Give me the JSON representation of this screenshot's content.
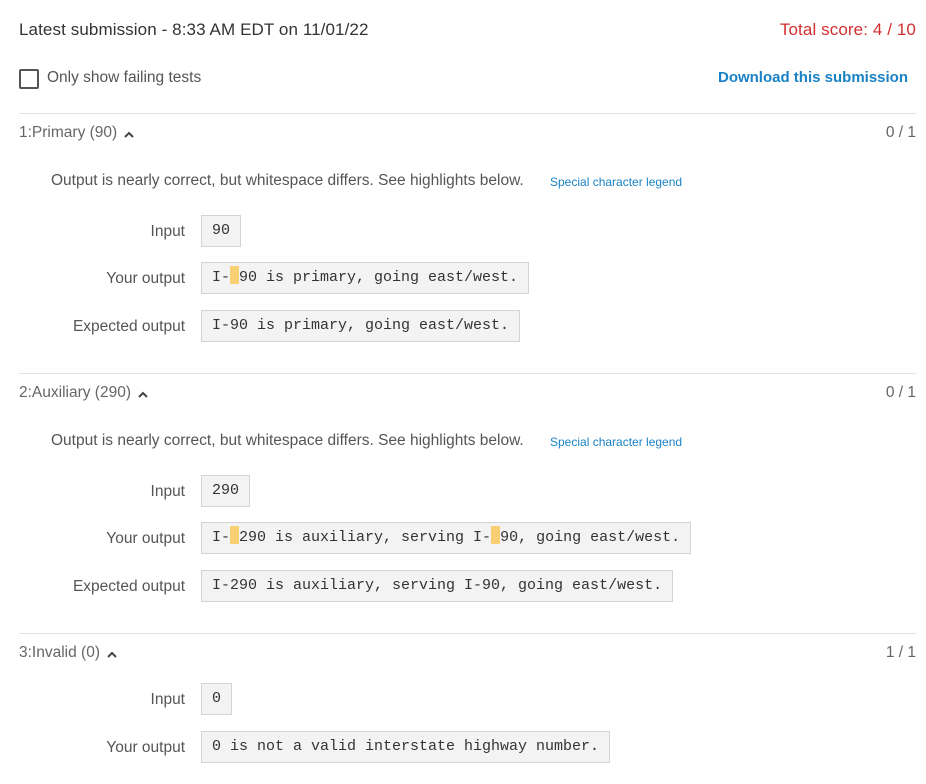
{
  "header": {
    "latest_submission": "Latest submission - 8:33 AM EDT on 11/01/22",
    "total_score": "Total score: 4 / 10"
  },
  "filter": {
    "only_failing_label": "Only show failing tests",
    "only_failing_checked": false,
    "download_label": "Download this submission"
  },
  "colors": {
    "score_red": "#d32f2f",
    "link_blue": "#1a82c4",
    "whitespace_highlight": "#f9cf73"
  },
  "labels": {
    "input": "Input",
    "your_output": "Your output",
    "expected_output": "Expected output"
  },
  "tests": [
    {
      "title": "1:Primary (90)",
      "score": "0 / 1",
      "message": "Output is nearly correct, but whitespace differs. See highlights below.",
      "legend_link": "Special character legend",
      "input": "90",
      "your_output_parts": [
        "I-",
        "90 is primary, going east/west."
      ],
      "expected_output": "I-90 is primary, going east/west."
    },
    {
      "title": "2:Auxiliary (290)",
      "score": "0 / 1",
      "message": "Output is nearly correct, but whitespace differs. See highlights below.",
      "legend_link": "Special character legend",
      "input": "290",
      "your_output_parts": [
        "I-",
        "290 is auxiliary, serving I-",
        "90, going east/west."
      ],
      "expected_output": "I-290 is auxiliary, serving I-90, going east/west."
    },
    {
      "title": "3:Invalid (0)",
      "score": "1 / 1",
      "input": "0",
      "your_output": "0 is not a valid interstate highway number."
    }
  ]
}
